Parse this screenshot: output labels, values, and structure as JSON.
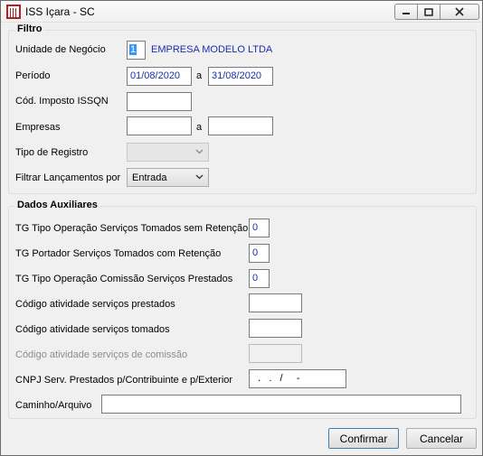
{
  "window": {
    "title": "ISS Içara - SC",
    "minimize_icon": "minimize-icon",
    "maximize_icon": "maximize-icon",
    "close_icon": "close-icon",
    "app_icon": "app-icon"
  },
  "filtro": {
    "legend": "Filtro",
    "unidade_label": "Unidade de Negócio",
    "unidade_code": "1",
    "unidade_name": "EMPRESA MODELO LTDA",
    "periodo_label": "Período",
    "periodo_start": "01/08/2020",
    "periodo_sep": "a",
    "periodo_end": "31/08/2020",
    "cod_imposto_label": "Cód. Imposto ISSQN",
    "cod_imposto_value": "",
    "empresas_label": "Empresas",
    "empresas_sep": "a",
    "empresas_start": "",
    "empresas_end": "",
    "tipo_registro_label": "Tipo de Registro",
    "tipo_registro_value": "",
    "filtrar_label": "Filtrar Lançamentos por",
    "filtrar_value": "Entrada"
  },
  "auxiliares": {
    "legend": "Dados Auxiliares",
    "tg_tipo_tomados_label": "TG Tipo Operação Serviços Tomados sem Retenção",
    "tg_tipo_tomados_value": "0",
    "tg_portador_label": "TG Portador Serviços Tomados com Retenção",
    "tg_portador_value": "0",
    "tg_comissao_label": "TG Tipo Operação Comissão Serviços Prestados",
    "tg_comissao_value": "0",
    "cod_prestados_label": "Código atividade serviços prestados",
    "cod_prestados_value": "",
    "cod_tomados_label": "Código atividade serviços tomados",
    "cod_tomados_value": "",
    "cod_comissao_label": "Código atividade serviços de comissão",
    "cod_comissao_value": "",
    "cnpj_label": "CNPJ Serv. Prestados p/Contribuinte e p/Exterior",
    "cnpj_value": "  .   .   /     -",
    "caminho_label": "Caminho/Arquivo",
    "caminho_value": ""
  },
  "buttons": {
    "confirmar": "Confirmar",
    "cancelar": "Cancelar"
  }
}
